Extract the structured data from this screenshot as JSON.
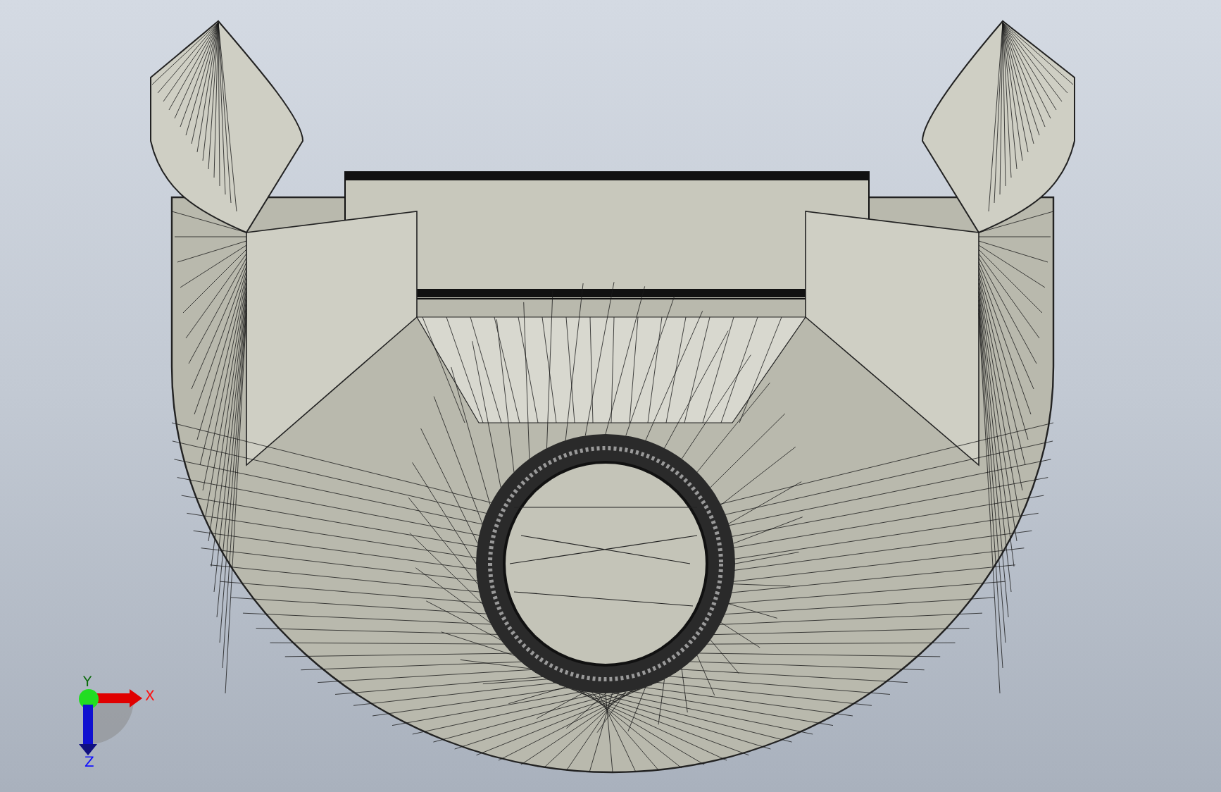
{
  "viewport": {
    "triad": {
      "axes": [
        {
          "kind": "x",
          "label": "X"
        },
        {
          "kind": "y",
          "label": "Y"
        },
        {
          "kind": "z",
          "label": "Z"
        }
      ]
    }
  }
}
